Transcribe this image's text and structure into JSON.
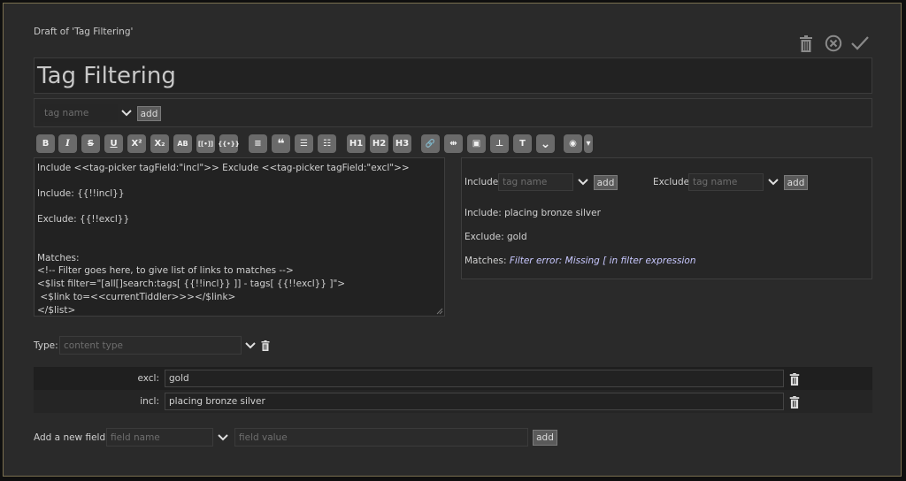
{
  "window": {
    "draft_label": "Draft of 'Tag Filtering'"
  },
  "toolbar": {
    "icons": [
      "trash-icon",
      "cancel-icon",
      "check-icon"
    ]
  },
  "title": {
    "value": "Tag Filtering"
  },
  "tag_input": {
    "placeholder": "tag name",
    "add_label": "add"
  },
  "format_toolbar": {
    "buttons": [
      {
        "name": "bold-button",
        "label": "B"
      },
      {
        "name": "italic-button",
        "label": "I"
      },
      {
        "name": "strikethrough-button",
        "label": "S"
      },
      {
        "name": "underline-button",
        "label": "U"
      },
      {
        "name": "superscript-button",
        "label": "X²"
      },
      {
        "name": "subscript-button",
        "label": "X₂"
      },
      {
        "name": "smallcaps-button",
        "label": "AB"
      },
      {
        "name": "link-transclude-button",
        "label": "[[•]]"
      },
      {
        "name": "transclude-button",
        "label": "{{•}}"
      },
      {
        "name": "monospace-block-button",
        "label": "≡"
      },
      {
        "name": "quote-button",
        "label": "❝"
      },
      {
        "name": "bullet-list-button",
        "label": "☰"
      },
      {
        "name": "numbered-list-button",
        "label": "☷"
      },
      {
        "name": "heading1-button",
        "label": "H1"
      },
      {
        "name": "heading2-button",
        "label": "H2"
      },
      {
        "name": "heading3-button",
        "label": "H3"
      },
      {
        "name": "link-button",
        "label": "🔗"
      },
      {
        "name": "rule-button",
        "label": "⇹"
      },
      {
        "name": "picture-button",
        "label": "▣"
      },
      {
        "name": "stamp-button",
        "label": "⊥"
      },
      {
        "name": "size-button",
        "label": "T"
      },
      {
        "name": "more-button",
        "label": "⌄"
      },
      {
        "name": "preview-button",
        "label": "◉"
      },
      {
        "name": "preview-type-button",
        "label": "▾"
      }
    ]
  },
  "editor": {
    "lines": [
      "Include <<tag-picker tagField:\"incl\">> Exclude <<tag-picker tagField:\"excl\">>",
      "",
      "Include: {{!!incl}}",
      "",
      "Exclude: {{!!excl}}",
      "",
      "",
      "Matches:",
      "<!-- Filter goes here, to give list of links to matches -->",
      "<$list filter=\"[all[]search:tags[ {{!!incl}} ]] - tags[ {{!!excl}} ]\">",
      " <$link to=<<currentTiddler>>></$link>",
      "</$list>"
    ]
  },
  "preview": {
    "include_label": "Include",
    "exclude_label": "Exclude",
    "tag_placeholder": "tag name",
    "add_label": "add",
    "include_line": "Include: placing bronze silver",
    "exclude_line": "Exclude: gold",
    "matches_label": "Matches:",
    "matches_error": "Filter error: Missing [ in filter expression"
  },
  "type_field": {
    "label": "Type:",
    "placeholder": "content type"
  },
  "fields": [
    {
      "name": "excl:",
      "value": "gold"
    },
    {
      "name": "incl:",
      "value": "placing bronze silver"
    }
  ],
  "new_field": {
    "label": "Add a new field:",
    "name_placeholder": "field name",
    "value_placeholder": "field value",
    "add_label": "add"
  }
}
